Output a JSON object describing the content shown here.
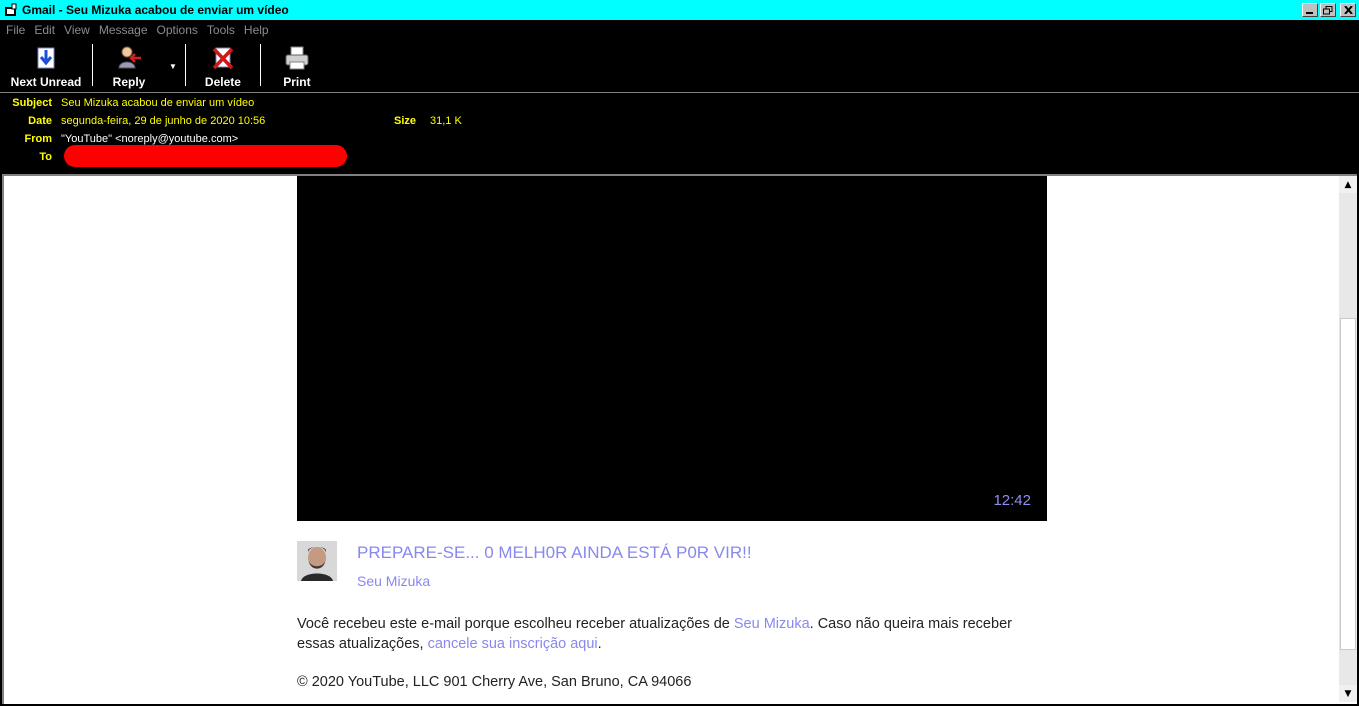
{
  "window": {
    "title": "Gmail - Seu Mizuka acabou de enviar um vídeo",
    "controls": [
      "minimize-icon",
      "maximize-icon",
      "close-icon"
    ]
  },
  "menu": {
    "file": "File",
    "edit": "Edit",
    "view": "View",
    "message": "Message",
    "options": "Options",
    "tools": "Tools",
    "help": "Help"
  },
  "toolbar": {
    "next_unread": "Next Unread",
    "reply": "Reply",
    "delete": "Delete",
    "print": "Print"
  },
  "header": {
    "subject_label": "Subject",
    "subject": "Seu Mizuka acabou de enviar um vídeo",
    "date_label": "Date",
    "date": "segunda-feira, 29 de junho de 2020 10:56",
    "size_label": "Size",
    "size": "31,1 K",
    "from_label": "From",
    "from": "\"YouTube\" <noreply@youtube.com>",
    "to_label": "To"
  },
  "email": {
    "video_duration": "12:42",
    "video_title": "PREPARE-SE... 0 MELH0R AINDA ESTÁ P0R VIR!!",
    "channel": "Seu Mizuka",
    "notice_part1": "Você recebeu este e-mail porque escolheu receber atualizações de ",
    "notice_channel_link": "Seu Mizuka",
    "notice_part2": ". Caso não queira mais receber essas atualizações, ",
    "notice_unsubscribe_link": "cancele sua inscrição aqui",
    "notice_part3": ".",
    "copyright": "© 2020 YouTube, LLC 901 Cherry Ave, San Bruno, CA 94066"
  },
  "colors": {
    "titlebar": "#00ffff",
    "header_text": "#ffff00",
    "link": "#8888ee",
    "redaction": "#ff0000"
  }
}
